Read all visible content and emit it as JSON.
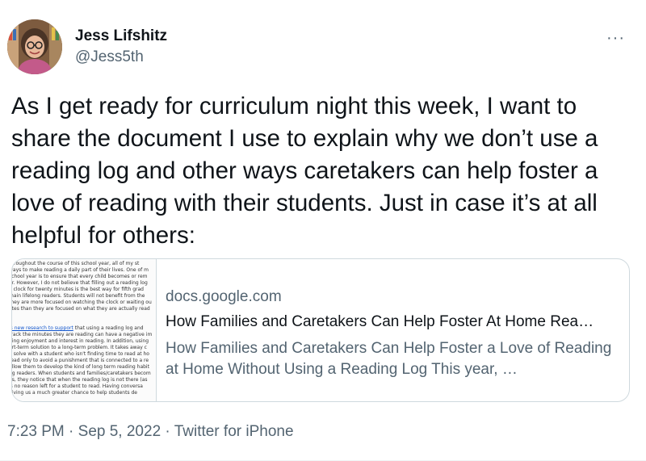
{
  "author": {
    "name": "Jess Lifshitz",
    "handle": "@Jess5th",
    "avatar_icon": "user-avatar"
  },
  "more_icon_glyph": "···",
  "tweet": {
    "text": "As I get ready for curriculum night this week, I want to share the document I use to explain why we don’t use a reading log and other ways caretakers can help foster a love of reading with their students. Just in case it’s at all helpful for others:"
  },
  "card": {
    "domain": "docs.google.com",
    "title": "How Families and Caretakers Can Help Foster At Home Rea…",
    "description": "How Families and Caretakers Can Help Foster a Love of Reading at Home Without Using a Reading Log This year, …",
    "thumbnail_lines": [
      "throughout the course of this school year, all of my st",
      "ways to make reading a daily part of their lives. One of m",
      "school year is to ensure that every child becomes or rem",
      "er. However, I do not believe that filling out a reading log",
      "a clock for twenty minutes is the best way for fifth grad",
      "main lifelong readers. Students will not benefit from the",
      "they are more focused on watching the clock or waiting ou",
      "ates than they are focused on what they are actually read",
      "",
      "",
      "is new research to support that using a reading log and",
      "track the minutes they are reading can have a negative im",
      "ding enjoyment and interest in reading. In addition, using",
      "ort-term solution to a long-term problem. It takes away c",
      "n solve with a student who isn't finding time to read at ho",
      "read only to avoid a punishment that is connected to a re",
      "allow them to develop the kind of long term reading habit",
      "ng readers. When students and families/caretakers becom",
      "ps, they notice that when the reading log is not there (as",
      "is no reason left for a student to read. Having conversa",
      "giving us a much greater chance to help students de"
    ],
    "thumbnail_link_text": "is new research to support"
  },
  "meta": {
    "time": "7:23 PM",
    "separator": " · ",
    "date": "Sep 5, 2022",
    "source": "Twitter for iPhone"
  },
  "colors": {
    "text_primary": "#0f1419",
    "text_secondary": "#536471",
    "border": "#cfd9de"
  }
}
